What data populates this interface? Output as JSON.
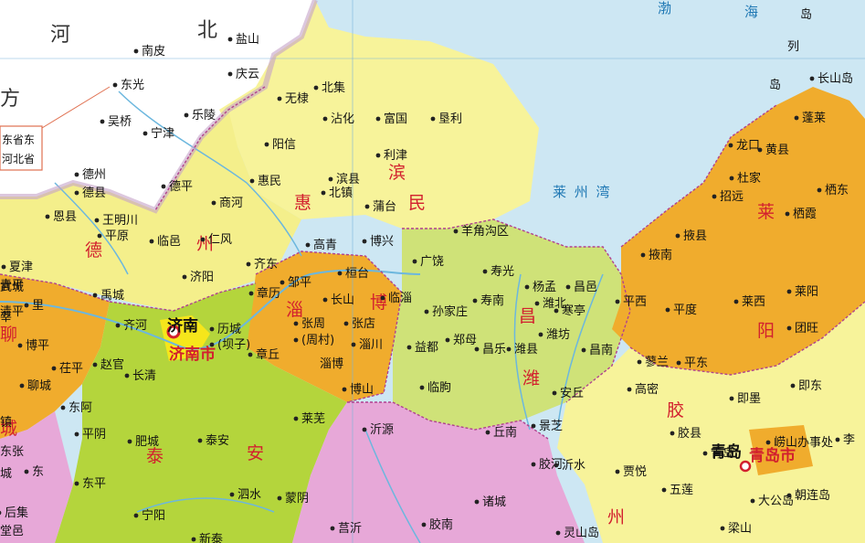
{
  "provinces": [
    "河",
    "北",
    "方"
  ],
  "legend_box": {
    "line1": "东省东",
    "line2": "河北省"
  },
  "seas": {
    "bohai": "渤",
    "bohai2": "海",
    "laizhou": "莱 州 湾",
    "islands": "岛",
    "lie": "列",
    "dao2": "岛"
  },
  "regions": {
    "de": "德",
    "zhou1": "州",
    "hui": "惠",
    "min": "民",
    "bin": "滨",
    "zi": "淄",
    "bo": "博",
    "wei": "潍",
    "chang": "昌",
    "lai": "莱",
    "yang": "阳",
    "jiao": "胶",
    "tai": "泰",
    "an": "安",
    "liao": "聊",
    "cheng": "城",
    "zhou2": "州"
  },
  "cities": {
    "jinan": "济南",
    "jinan_shi": "济南市",
    "qingdao": "青岛",
    "qingdao_shi": "青岛市",
    "zibo": "淄博"
  },
  "places": [
    "南皮",
    "盐山",
    "庆云",
    "东光",
    "吴桥",
    "宁津",
    "乐陵",
    "无棣",
    "北集",
    "沾化",
    "富国",
    "垦利",
    "阳信",
    "利津",
    "德州",
    "德县",
    "德平",
    "商河",
    "惠民",
    "滨县",
    "北镇",
    "蒲台",
    "恩县",
    "王明川",
    "平原",
    "临邑",
    "仁风",
    "高青",
    "博兴",
    "广饶",
    "羊角沟区",
    "夏津",
    "武城",
    "清平",
    "禹城",
    "齐东",
    "桓台",
    "邹平",
    "章历",
    "长山",
    "临淄",
    "寿光",
    "杨孟",
    "昌邑",
    "潍北",
    "寒亭",
    "孙家庄",
    "寿南",
    "济阳",
    "齐河",
    "历城",
    "(坝子)",
    "张周",
    "(周村)",
    "张店",
    "淄川",
    "益都",
    "郑母",
    "昌乐",
    "潍县",
    "潍坊",
    "昌南",
    "平西",
    "平度",
    "莱西",
    "莱阳",
    "团旺",
    "蓬莱",
    "龙口",
    "黄县",
    "长山岛",
    "杜家",
    "招远",
    "栖东",
    "栖霞",
    "掖县",
    "掖南",
    "博平",
    "茌平",
    "聊城",
    "东阿",
    "章丘",
    "赵官",
    "长清",
    "博山",
    "临朐",
    "安丘",
    "高密",
    "蓼兰",
    "平东",
    "即墨",
    "即东",
    "平阴",
    "肥城",
    "泰安",
    "莱芜",
    "沂源",
    "丘南",
    "景芝",
    "胶县",
    "崂山办事处",
    "李",
    "青岛",
    "大公岛",
    "朝连岛",
    "东平",
    "宁阳",
    "泗水",
    "新泰",
    "蒙阴",
    "莒沂",
    "诸城",
    "胶河",
    "贾悦",
    "沂水",
    "胶南",
    "五莲",
    "灵山岛",
    "梁山",
    "后集",
    "堂邑",
    "东张",
    "城",
    "镇",
    "青平",
    "莘",
    "东",
    "里"
  ]
}
